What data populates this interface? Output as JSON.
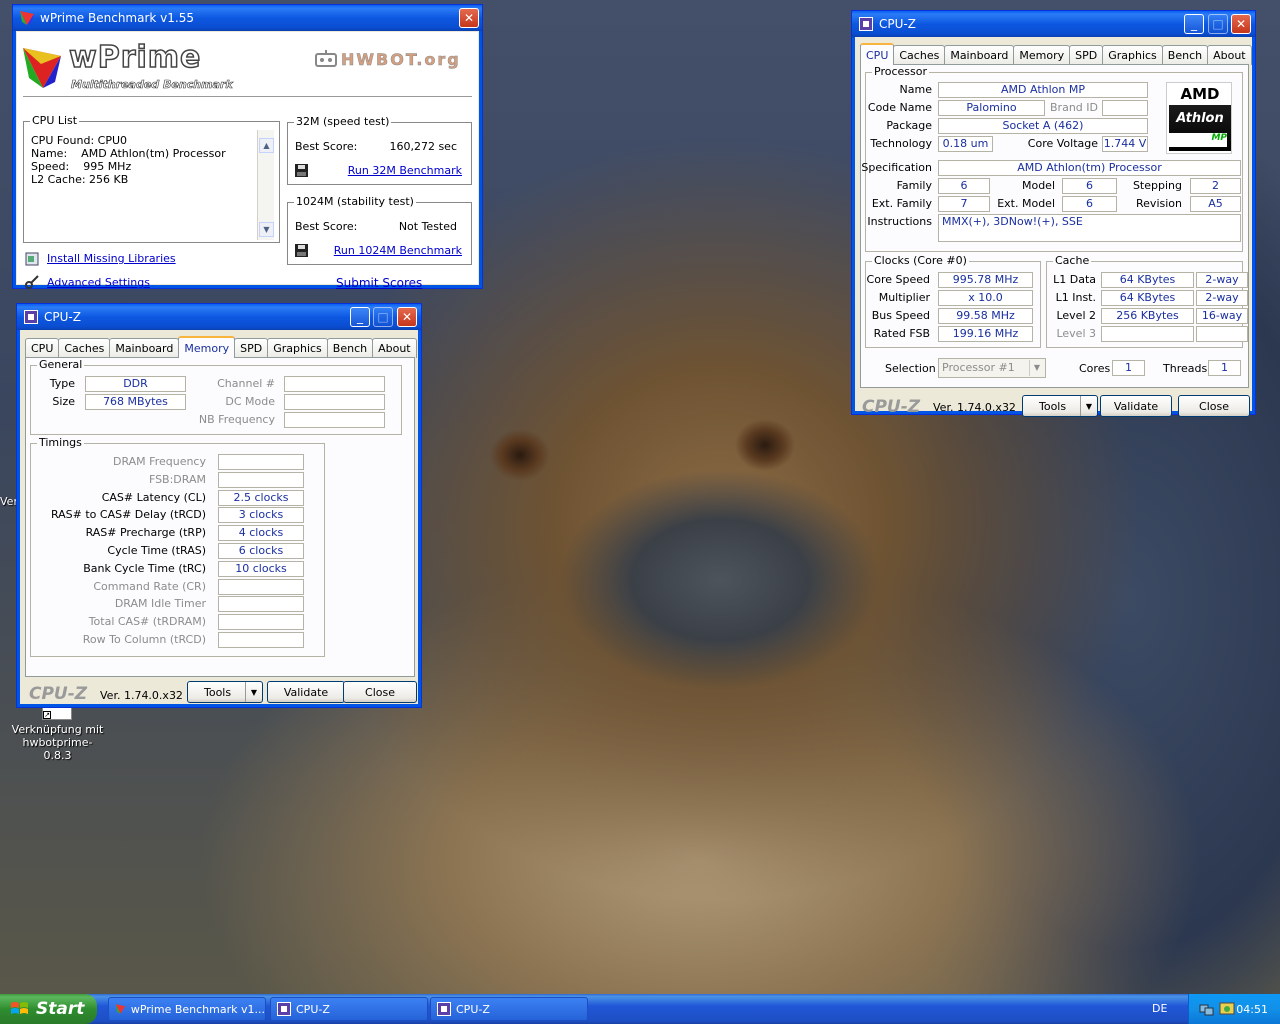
{
  "desktop": {
    "shortcut_label_line1": "Verknüpfung mit",
    "shortcut_label_line2": "hwbotprime-0.8.3",
    "partial_label": "Ver"
  },
  "wprime": {
    "title": "wPrime Benchmark v1.55",
    "logo_main": "wPrime",
    "logo_sub": "Multithreaded Benchmark",
    "hwbot_logo": "HWBOT.org",
    "cpu_list": {
      "heading": "CPU List",
      "line1": "CPU Found: CPU0",
      "line2_label": "Name:",
      "line2_value": "AMD Athlon(tm) Processor",
      "line3_label": "Speed:",
      "line3_value": "995 MHz",
      "line4": "L2 Cache: 256 KB"
    },
    "test32": {
      "heading": "32M (speed test)",
      "best_label": "Best Score:",
      "best_value": "160,272 sec",
      "run_label": "Run 32M Benchmark"
    },
    "test1024": {
      "heading": "1024M (stability test)",
      "best_label": "Best Score:",
      "best_value": "Not Tested",
      "run_label": "Run 1024M Benchmark"
    },
    "install_libs": "Install Missing Libraries",
    "advanced": "Advanced Settings",
    "submit": "Submit Scores"
  },
  "cpuz_mem": {
    "title": "CPU-Z",
    "tabs": [
      "CPU",
      "Caches",
      "Mainboard",
      "Memory",
      "SPD",
      "Graphics",
      "Bench",
      "About"
    ],
    "active_tab": "Memory",
    "general": {
      "heading": "General",
      "type_label": "Type",
      "type_value": "DDR",
      "size_label": "Size",
      "size_value": "768 MBytes",
      "channel_label": "Channel #",
      "dc_label": "DC Mode",
      "nb_label": "NB Frequency"
    },
    "timings": {
      "heading": "Timings",
      "rows": [
        {
          "label": "DRAM Frequency",
          "value": "",
          "dim": true
        },
        {
          "label": "FSB:DRAM",
          "value": "",
          "dim": true
        },
        {
          "label": "CAS# Latency (CL)",
          "value": "2.5 clocks",
          "dim": false
        },
        {
          "label": "RAS# to CAS# Delay (tRCD)",
          "value": "3 clocks",
          "dim": false
        },
        {
          "label": "RAS# Precharge (tRP)",
          "value": "4 clocks",
          "dim": false
        },
        {
          "label": "Cycle Time (tRAS)",
          "value": "6 clocks",
          "dim": false
        },
        {
          "label": "Bank Cycle Time (tRC)",
          "value": "10 clocks",
          "dim": false
        },
        {
          "label": "Command Rate (CR)",
          "value": "",
          "dim": true
        },
        {
          "label": "DRAM Idle Timer",
          "value": "",
          "dim": true
        },
        {
          "label": "Total CAS# (tRDRAM)",
          "value": "",
          "dim": true
        },
        {
          "label": "Row To Column (tRCD)",
          "value": "",
          "dim": true
        }
      ]
    },
    "footer": {
      "brand": "CPU-Z",
      "version": "Ver. 1.74.0.x32",
      "tools": "Tools",
      "validate": "Validate",
      "close": "Close"
    }
  },
  "cpuz_cpu": {
    "title": "CPU-Z",
    "tabs": [
      "CPU",
      "Caches",
      "Mainboard",
      "Memory",
      "SPD",
      "Graphics",
      "Bench",
      "About"
    ],
    "active_tab": "CPU",
    "processor": {
      "heading": "Processor",
      "name_label": "Name",
      "name_value": "AMD Athlon MP",
      "codename_label": "Code Name",
      "codename_value": "Palomino",
      "brandid_label": "Brand ID",
      "brandid_value": "",
      "package_label": "Package",
      "package_value": "Socket A (462)",
      "tech_label": "Technology",
      "tech_value": "0.18 um",
      "voltage_label": "Core Voltage",
      "voltage_value": "1.744 V",
      "spec_label": "Specification",
      "spec_value": "AMD Athlon(tm) Processor",
      "family_label": "Family",
      "family_value": "6",
      "model_label": "Model",
      "model_value": "6",
      "stepping_label": "Stepping",
      "stepping_value": "2",
      "extfamily_label": "Ext. Family",
      "extfamily_value": "7",
      "extmodel_label": "Ext. Model",
      "extmodel_value": "6",
      "revision_label": "Revision",
      "revision_value": "A5",
      "instr_label": "Instructions",
      "instr_value": "MMX(+), 3DNow!(+), SSE",
      "logo_amd": "AMD",
      "logo_athlon": "Athlon",
      "logo_mp": "MP"
    },
    "clocks": {
      "heading": "Clocks (Core #0)",
      "core_label": "Core Speed",
      "core_value": "995.78 MHz",
      "mult_label": "Multiplier",
      "mult_value": "x 10.0",
      "bus_label": "Bus Speed",
      "bus_value": "99.58 MHz",
      "fsb_label": "Rated FSB",
      "fsb_value": "199.16 MHz"
    },
    "cache": {
      "heading": "Cache",
      "l1d_label": "L1 Data",
      "l1d_size": "64 KBytes",
      "l1d_way": "2-way",
      "l1i_label": "L1 Inst.",
      "l1i_size": "64 KBytes",
      "l1i_way": "2-way",
      "l2_label": "Level 2",
      "l2_size": "256 KBytes",
      "l2_way": "16-way",
      "l3_label": "Level 3",
      "l3_size": "",
      "l3_way": ""
    },
    "selection_label": "Selection",
    "selection_value": "Processor #1",
    "cores_label": "Cores",
    "cores_value": "1",
    "threads_label": "Threads",
    "threads_value": "1",
    "footer": {
      "brand": "CPU-Z",
      "version": "Ver. 1.74.0.x32",
      "tools": "Tools",
      "validate": "Validate",
      "close": "Close"
    }
  },
  "taskbar": {
    "start": "Start",
    "tasks": [
      "wPrime Benchmark v1...",
      "CPU-Z",
      "CPU-Z"
    ],
    "lang": "DE",
    "clock": "04:51"
  },
  "colors": {
    "accent": "#0055e5",
    "value_text": "#1a2fa0",
    "link": "#0000cc"
  }
}
